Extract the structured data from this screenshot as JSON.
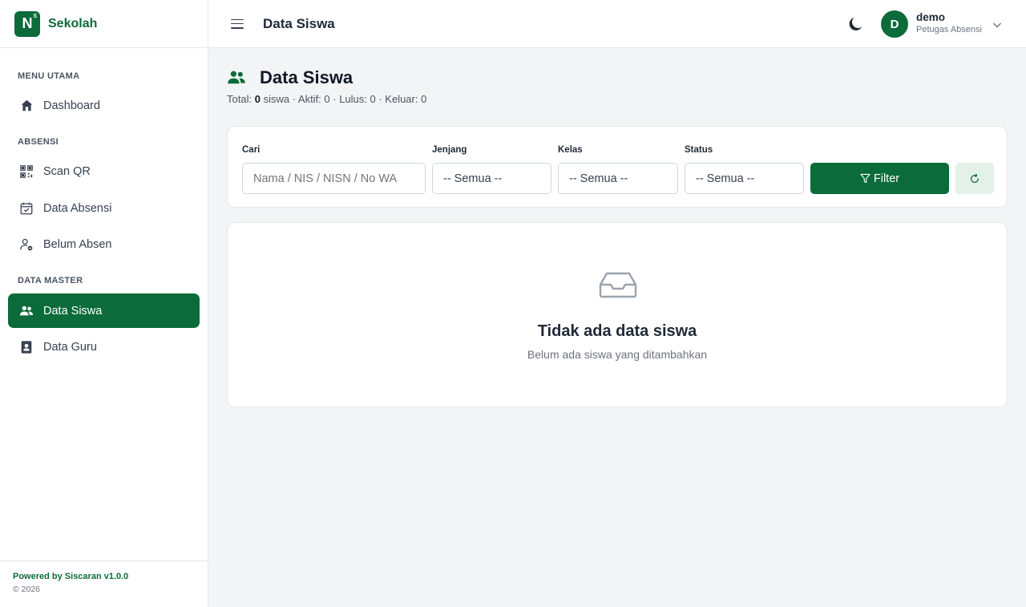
{
  "brand": {
    "logo_letter": "N",
    "logo_mark": "S",
    "name": "Sekolah"
  },
  "sidebar": {
    "sections": [
      {
        "label": "MENU UTAMA"
      },
      {
        "label": "ABSENSI"
      },
      {
        "label": "DATA MASTER"
      }
    ],
    "items": [
      {
        "label": "Dashboard",
        "icon": "home-icon"
      },
      {
        "label": "Scan QR",
        "icon": "qr-code-icon"
      },
      {
        "label": "Data Absensi",
        "icon": "calendar-check-icon"
      },
      {
        "label": "Belum Absen",
        "icon": "user-minus-icon"
      },
      {
        "label": "Data Siswa",
        "icon": "users-icon",
        "active": true
      },
      {
        "label": "Data Guru",
        "icon": "contact-book-icon"
      }
    ],
    "footer": {
      "powered": "Powered by Siscaran v1.0.0",
      "copyright": "© 2026"
    }
  },
  "topbar": {
    "title": "Data Siswa",
    "user": {
      "initial": "D",
      "name": "demo",
      "role": "Petugas Absensi"
    }
  },
  "page": {
    "title": "Data Siswa",
    "summary": {
      "total_prefix": "Total:",
      "total_count": "0",
      "total_suffix": "siswa · Aktif: 0 · Lulus: 0 · Keluar: 0"
    }
  },
  "filters": {
    "search": {
      "label": "Cari",
      "placeholder": "Nama / NIS / NISN / No WA"
    },
    "jenjang": {
      "label": "Jenjang",
      "value": "-- Semua --"
    },
    "kelas": {
      "label": "Kelas",
      "value": "-- Semua --"
    },
    "status": {
      "label": "Status",
      "value": "-- Semua --"
    },
    "filter_button": "Filter"
  },
  "empty": {
    "title": "Tidak ada data siswa",
    "description": "Belum ada siswa yang ditambahkan"
  },
  "colors": {
    "primary": "#0b6b3a",
    "background": "#f3f4f6",
    "reset_bg": "#e3f1e8"
  }
}
